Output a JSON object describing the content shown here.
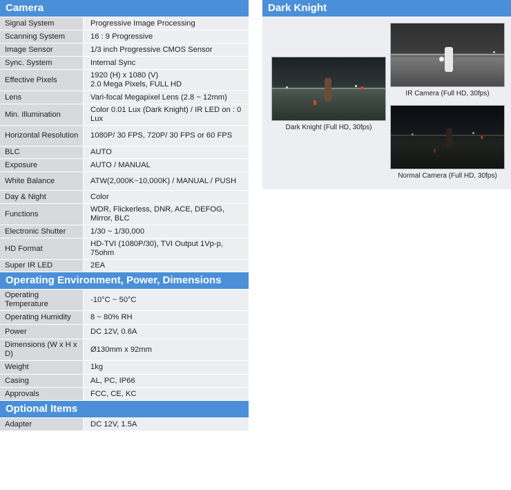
{
  "sections": {
    "camera": {
      "title": "Camera",
      "rows": [
        {
          "label": "Signal System",
          "value": "Progressive Image Processing"
        },
        {
          "label": "Scanning System",
          "value": "16 : 9 Progressive"
        },
        {
          "label": "Image Sensor",
          "value": "1/3 inch Progressive CMOS Sensor"
        },
        {
          "label": "Sync. System",
          "value": "Internal Sync"
        },
        {
          "label": "Effective Pixels",
          "value": "1920 (H) x 1080 (V)\n2.0 Mega Pixels, FULL HD"
        },
        {
          "label": "Lens",
          "value": "Vari-focal Megapixel Lens (2.8 ~ 12mm)"
        },
        {
          "label": "Min. Illumination",
          "value": "Color 0.01 Lux (Dark Knight) / IR LED on : 0 Lux"
        },
        {
          "label": "Horizontal Resolution",
          "value": "1080P/ 30 FPS, 720P/ 30 FPS or 60 FPS"
        },
        {
          "label": "BLC",
          "value": "AUTO"
        },
        {
          "label": "Exposure",
          "value": "AUTO / MANUAL"
        },
        {
          "label": "White Balance",
          "value": "ATW(2,000K~10,000K) / MANUAL / PUSH"
        },
        {
          "label": "Day & Night",
          "value": "Color"
        },
        {
          "label": "Functions",
          "value": "WDR, Flickerless, DNR, ACE, DEFOG, Mirror, BLC"
        },
        {
          "label": "Electronic Shutter",
          "value": "1/30 ~ 1/30,000"
        },
        {
          "label": "HD Format",
          "value": "HD-TVI (1080P/30), TVI Output 1Vp-p, 75ohm"
        },
        {
          "label": "Super IR LED",
          "value": "2EA"
        }
      ]
    },
    "environment": {
      "title": "Operating Environment, Power, Dimensions",
      "rows": [
        {
          "label": "Operating Temperature",
          "value": "-10°C ~ 50°C"
        },
        {
          "label": "Operating Humidity",
          "value": "8 ~ 80% RH"
        },
        {
          "label": "Power",
          "value": "DC 12V, 0.6A"
        },
        {
          "label": "Dimensions (W x H x D)",
          "value": "Ø130mm x 92mm"
        },
        {
          "label": "Weight",
          "value": "1kg"
        },
        {
          "label": "Casing",
          "value": "AL, PC, IP66"
        },
        {
          "label": "Approvals",
          "value": "FCC, CE, KC"
        }
      ]
    },
    "optional": {
      "title": "Optional Items",
      "rows": [
        {
          "label": "Adapter",
          "value": "DC 12V, 1.5A"
        }
      ]
    }
  },
  "dark_knight": {
    "title": "Dark Knight",
    "photos": [
      {
        "caption": "Dark Knight (Full HD, 30fps)"
      },
      {
        "caption": "IR Camera (Full HD, 30fps)"
      },
      {
        "caption": "Normal Camera (Full HD, 30fps)"
      }
    ]
  }
}
